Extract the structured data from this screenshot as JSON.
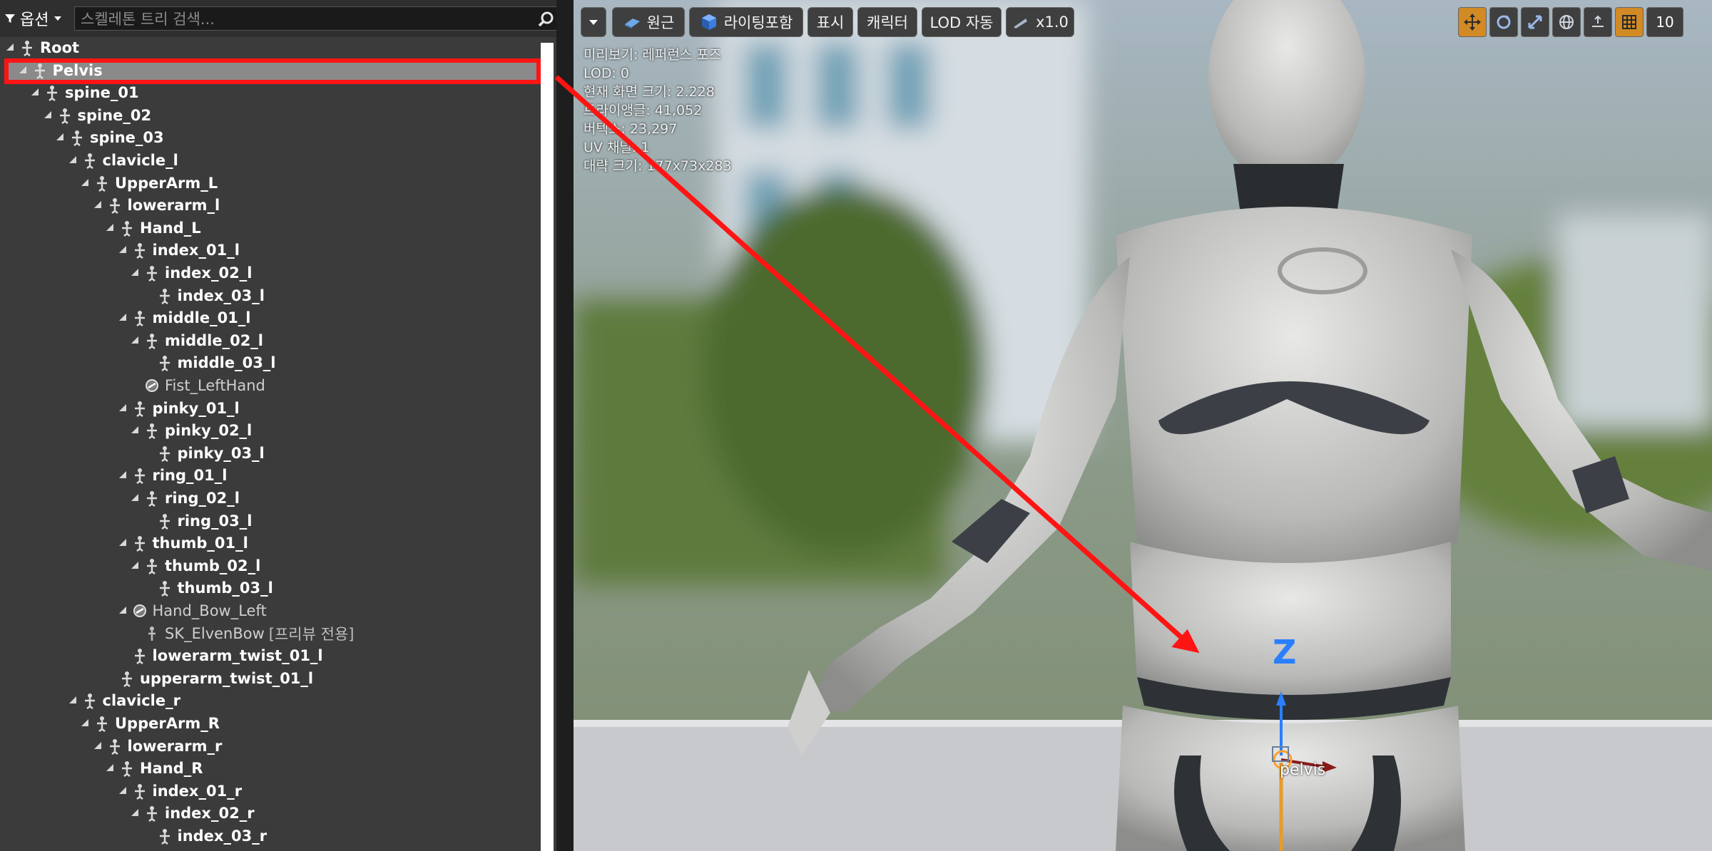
{
  "options": {
    "label": "옵션"
  },
  "search": {
    "placeholder": "스켈레톤 트리 검색..."
  },
  "tree": [
    {
      "label": "Root",
      "depth": 0,
      "type": "bone",
      "expanded": true
    },
    {
      "label": "Pelvis",
      "depth": 1,
      "type": "bone",
      "expanded": true,
      "selected": true
    },
    {
      "label": "spine_01",
      "depth": 2,
      "type": "bone",
      "expanded": true
    },
    {
      "label": "spine_02",
      "depth": 3,
      "type": "bone",
      "expanded": true
    },
    {
      "label": "spine_03",
      "depth": 4,
      "type": "bone",
      "expanded": true
    },
    {
      "label": "clavicle_l",
      "depth": 5,
      "type": "bone",
      "expanded": true
    },
    {
      "label": "UpperArm_L",
      "depth": 6,
      "type": "bone",
      "expanded": true
    },
    {
      "label": "lowerarm_l",
      "depth": 7,
      "type": "bone",
      "expanded": true
    },
    {
      "label": "Hand_L",
      "depth": 8,
      "type": "bone",
      "expanded": true
    },
    {
      "label": "index_01_l",
      "depth": 9,
      "type": "bone",
      "expanded": true
    },
    {
      "label": "index_02_l",
      "depth": 10,
      "type": "bone",
      "expanded": true
    },
    {
      "label": "index_03_l",
      "depth": 11,
      "type": "bone",
      "leaf": true
    },
    {
      "label": "middle_01_l",
      "depth": 9,
      "type": "bone",
      "expanded": true
    },
    {
      "label": "middle_02_l",
      "depth": 10,
      "type": "bone",
      "expanded": true
    },
    {
      "label": "middle_03_l",
      "depth": 11,
      "type": "bone",
      "leaf": true
    },
    {
      "label": "Fist_LeftHand",
      "depth": 10,
      "type": "socket",
      "leaf": true
    },
    {
      "label": "pinky_01_l",
      "depth": 9,
      "type": "bone",
      "expanded": true
    },
    {
      "label": "pinky_02_l",
      "depth": 10,
      "type": "bone",
      "expanded": true
    },
    {
      "label": "pinky_03_l",
      "depth": 11,
      "type": "bone",
      "leaf": true
    },
    {
      "label": "ring_01_l",
      "depth": 9,
      "type": "bone",
      "expanded": true
    },
    {
      "label": "ring_02_l",
      "depth": 10,
      "type": "bone",
      "expanded": true
    },
    {
      "label": "ring_03_l",
      "depth": 11,
      "type": "bone",
      "leaf": true
    },
    {
      "label": "thumb_01_l",
      "depth": 9,
      "type": "bone",
      "expanded": true
    },
    {
      "label": "thumb_02_l",
      "depth": 10,
      "type": "bone",
      "expanded": true
    },
    {
      "label": "thumb_03_l",
      "depth": 11,
      "type": "bone",
      "leaf": true
    },
    {
      "label": "Hand_Bow_Left",
      "depth": 9,
      "type": "socket",
      "expanded": true
    },
    {
      "label": "SK_ElvenBow",
      "extra": "[프리뷰 전용]",
      "depth": 10,
      "type": "mesh",
      "leaf": true
    },
    {
      "label": "lowerarm_twist_01_l",
      "depth": 9,
      "type": "bone",
      "leaf": true
    },
    {
      "label": "upperarm_twist_01_l",
      "depth": 8,
      "type": "bone",
      "leaf": true
    },
    {
      "label": "clavicle_r",
      "depth": 5,
      "type": "bone",
      "expanded": true
    },
    {
      "label": "UpperArm_R",
      "depth": 6,
      "type": "bone",
      "expanded": true
    },
    {
      "label": "lowerarm_r",
      "depth": 7,
      "type": "bone",
      "expanded": true
    },
    {
      "label": "Hand_R",
      "depth": 8,
      "type": "bone",
      "expanded": true
    },
    {
      "label": "index_01_r",
      "depth": 9,
      "type": "bone",
      "expanded": true
    },
    {
      "label": "index_02_r",
      "depth": 10,
      "type": "bone",
      "expanded": true
    },
    {
      "label": "index_03_r",
      "depth": 11,
      "type": "bone",
      "leaf": true
    }
  ],
  "toolbar": {
    "perspective": "원근",
    "lighting": "라이팅포함",
    "show": "표시",
    "character": "캐릭터",
    "lod": "LOD 자동",
    "speed": "x1.0"
  },
  "stats": [
    "미리보기: 레퍼런스 포즈",
    "LOD: 0",
    "현재 화면 크기: 2.228",
    "트라이앵글: 41,052",
    "버텍스: 23,297",
    "UV 채널: 1",
    "대략 크기: 177x73x283"
  ],
  "grid_size": "10",
  "gizmo": {
    "axis_label": "Z",
    "bone_label": "pelvis"
  },
  "colors": {
    "highlight": "#ff1414",
    "accent": "#d28a24",
    "z_axis": "#2a7fff"
  }
}
